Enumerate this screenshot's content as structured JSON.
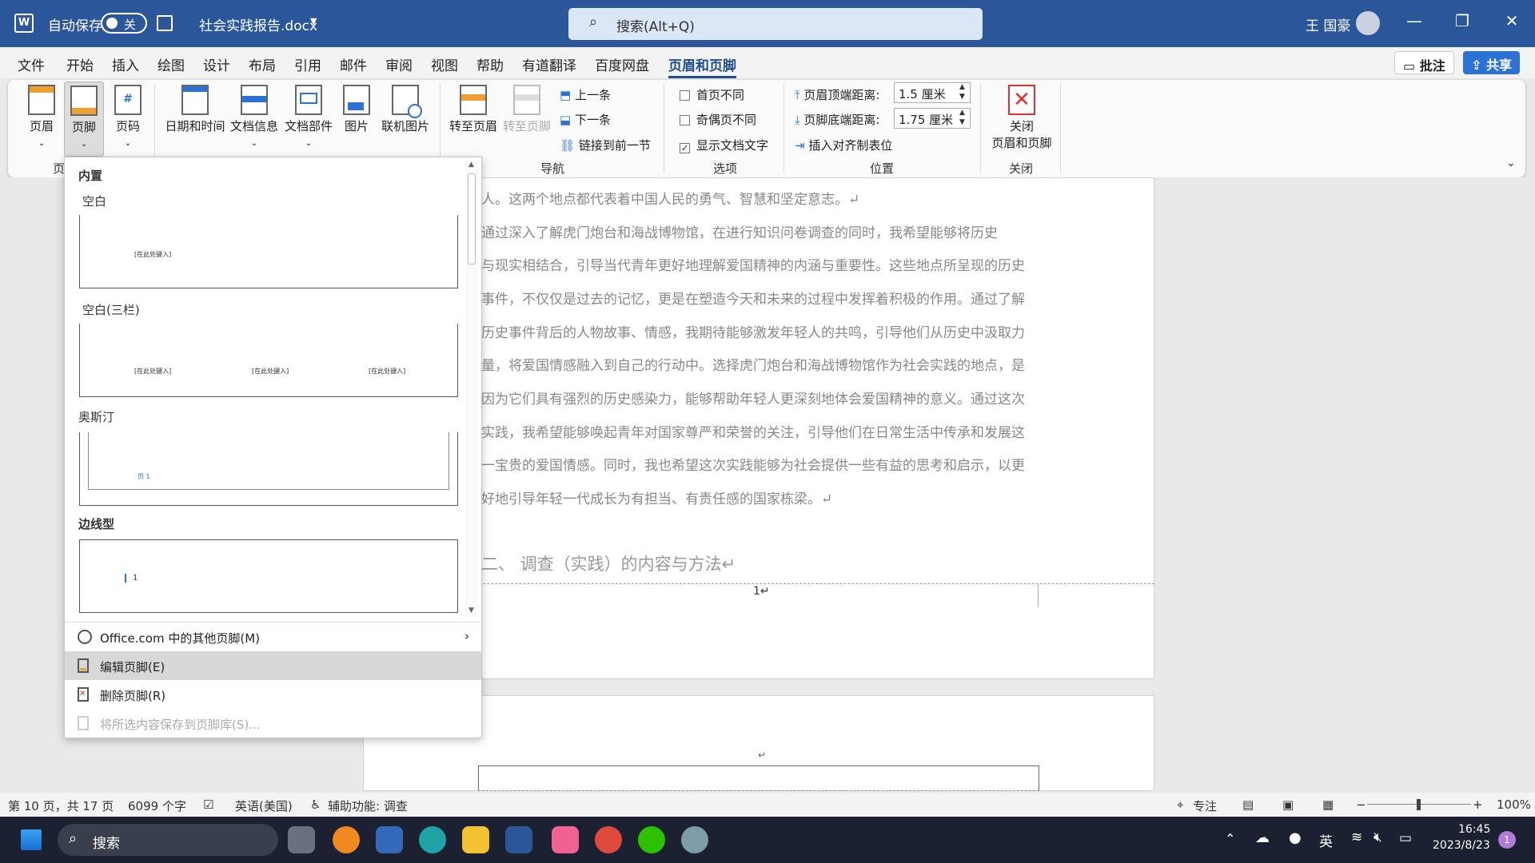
{
  "titlebar": {
    "autosave_label": "自动保存",
    "autosave_state": "关",
    "filename": "社会实践报告.docx",
    "search_placeholder": "搜索(Alt+Q)",
    "user_name": "王 国豪"
  },
  "menu": {
    "items": [
      "文件",
      "开始",
      "插入",
      "绘图",
      "设计",
      "布局",
      "引用",
      "邮件",
      "审阅",
      "视图",
      "帮助",
      "有道翻译",
      "百度网盘",
      "页眉和页脚"
    ],
    "active": "页眉和页脚",
    "comment_btn": "批注",
    "share_btn": "共享"
  },
  "ribbon": {
    "header_btn": "页眉",
    "footer_btn": "页脚",
    "pagenum_btn": "页码",
    "datetime_btn": "日期和时间",
    "docinfo_btn": "文档信息",
    "docparts_btn": "文档部件",
    "picture_btn": "图片",
    "online_pic_btn": "联机图片",
    "goto_header_btn": "转至页眉",
    "goto_footer_btn": "转至页脚",
    "prev_btn": "上一条",
    "next_btn": "下一条",
    "link_prev_btn": "链接到前一节",
    "nav_group": "导航",
    "diff_first": "首页不同",
    "diff_oddeven": "奇偶页不同",
    "show_doc_text": "显示文档文字",
    "options_group": "选项",
    "header_top_label": "页眉顶端距离:",
    "header_top_value": "1.5 厘米",
    "footer_bottom_label": "页脚底端距离:",
    "footer_bottom_value": "1.75 厘米",
    "insert_align_tab": "插入对齐制表位",
    "position_group": "位置",
    "close_btn_line1": "关闭",
    "close_btn_line2": "页眉和页脚",
    "close_group": "关闭",
    "hf_group_partial": "页"
  },
  "dropdown": {
    "section": "内置",
    "templates": [
      {
        "name": "空白",
        "placeholders": [
          "[在此处键入]"
        ]
      },
      {
        "name": "空白(三栏)",
        "placeholders": [
          "[在此处键入]",
          "[在此处键入]",
          "[在此处键入]"
        ]
      },
      {
        "name": "奥斯汀",
        "placeholders": [
          "页 1"
        ]
      },
      {
        "name": "边线型",
        "placeholders": [
          "1"
        ]
      }
    ],
    "more_online": "Office.com 中的其他页脚(M)",
    "edit_footer": "编辑页脚(E)",
    "remove_footer": "删除页脚(R)",
    "save_to_gallery": "将所选内容保存到页脚库(S)..."
  },
  "document": {
    "lines": [
      "人。这两个地点都代表着中国人民的勇气、智慧和坚定意志。↵",
      "    通过深入了解虎门炮台和海战博物馆，在进行知识问卷调查的同时，我希望能够将历史",
      "与现实相结合，引导当代青年更好地理解爱国精神的内涵与重要性。这些地点所呈现的历史",
      "事件，不仅仅是过去的记忆，更是在塑造今天和未来的过程中发挥着积极的作用。通过了解",
      "历史事件背后的人物故事、情感，我期待能够激发年轻人的共鸣，引导他们从历史中汲取力",
      "量，将爱国情感融入到自己的行动中。选择虎门炮台和海战博物馆作为社会实践的地点，是",
      "因为它们具有强烈的历史感染力，能够帮助年轻人更深刻地体会爱国精神的意义。通过这次",
      "实践，我希望能够唤起青年对国家尊严和荣誉的关注，引导他们在日常生活中传承和发展这",
      "一宝贵的爱国情感。同时，我也希望这次实践能够为社会提供一些有益的思考和启示，以更",
      "好地引导年轻一代成长为有担当、有责任感的国家栋梁。↵"
    ],
    "heading": "二、    调查（实践）的内容与方法↵",
    "footer_page": "1↵"
  },
  "status": {
    "page": "第 10 页，共 17 页",
    "words": "6099 个字",
    "language": "英语(美国)",
    "accessibility": "辅助功能: 调查",
    "focus": "专注",
    "zoom": "100%"
  },
  "taskbar": {
    "search": "搜索",
    "ime": "英",
    "time": "16:45",
    "date": "2023/8/23",
    "badge": "1"
  },
  "colors": {
    "word_blue": "#2b579a",
    "taskbar": "#1c2131"
  }
}
